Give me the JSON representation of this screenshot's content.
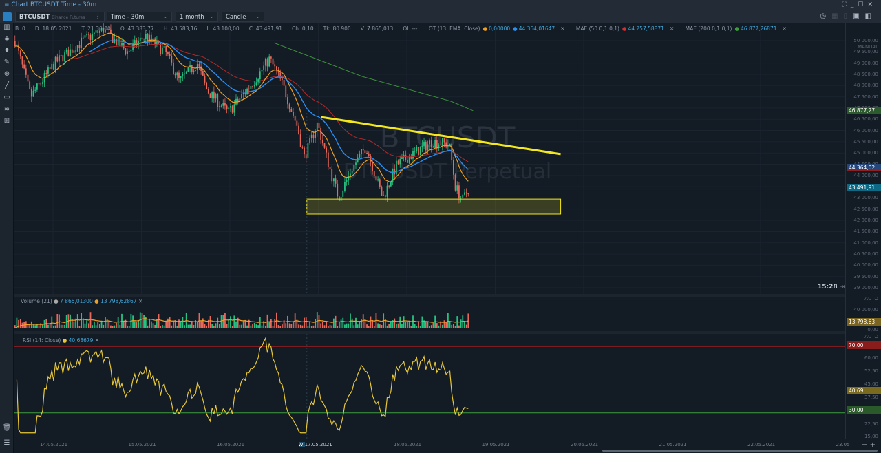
{
  "window": {
    "title": "Chart BTCUSDT Time - 30m",
    "controls": [
      "⛶",
      "_",
      "☐",
      "✕"
    ]
  },
  "toolbar": {
    "symbol": "BTCUSDT",
    "exchange": "Binance Futures",
    "timeframe": "Time - 30m",
    "range": "1 month",
    "chart_type": "Candle"
  },
  "legend": {
    "b": "B: 0",
    "d": "D: 18.05.2021",
    "t": "T: 21:30:00",
    "o": "O: 43 383,77",
    "h": "H: 43 583,16",
    "l": "L: 43 100,00",
    "c": "C: 43 491,91",
    "ch": "Ch: 0,10",
    "tk": "Tk: 80 900",
    "v": "V: 7 865,013",
    "oi": "OI: ---",
    "ind1": "OT (13: EMA: Close)",
    "ind1_v1": "0,00000",
    "ind1_v2": "44 364,01647",
    "ind2": "MAE (50:0,1:0,1)",
    "ind2_v": "44 257,58871",
    "ind3": "MAE (200:0,1:0,1)",
    "ind3_v": "46 877,26871",
    "mode": "MANUAL"
  },
  "price_axis": {
    "ticks": [
      "50 000,00",
      "49 500,00",
      "49 000,00",
      "48 500,00",
      "48 000,00",
      "47 500,00",
      "47 000,00",
      "46 500,00",
      "46 000,00",
      "45 500,00",
      "45 000,00",
      "44 500,00",
      "44 000,00",
      "43 500,00",
      "43 000,00",
      "42 500,00",
      "42 000,00",
      "41 500,00",
      "41 000,00",
      "40 500,00",
      "40 000,00",
      "39 500,00",
      "39 000,00"
    ],
    "badges": {
      "ma200": "46 877,27",
      "ema": "44 364,02",
      "last": "43 491,91"
    },
    "clock": "15:28"
  },
  "volume_pane": {
    "title": "Volume (21)",
    "v1": "7 865,01300",
    "v2": "13 798,62867",
    "axis_mode": "AUTO",
    "ticks": [
      "40 000,00",
      "0,00"
    ],
    "badge": "13 798,63"
  },
  "rsi_pane": {
    "title": "RSI (14: Close)",
    "value": "40,68679",
    "axis_mode": "AUTO",
    "ticks": [
      "60,00",
      "52,50",
      "45,00",
      "37,50",
      "22,50",
      "15,00"
    ],
    "upper": "70,00",
    "lower": "30,00",
    "badge": "40,69"
  },
  "time_axis": {
    "dates": [
      "14.05.2021",
      "15.05.2021",
      "16.05.2021",
      "17.05.2021",
      "18.05.2021",
      "19.05.2021",
      "20.05.2021",
      "21.05.2021",
      "22.05.2021",
      "23.05"
    ],
    "week_marker": "W"
  },
  "watermark": {
    "symbol": "BTCUSDT",
    "name": "BTC USDT Perpetual"
  },
  "colors": {
    "up": "#26c281",
    "down": "#e8685a",
    "ema": "#2a8ef0",
    "ma50": "#b02a2a",
    "ma200": "#3c8f3c",
    "fast": "#f0a020",
    "trend": "#f4e81c",
    "rsi": "#e8c838"
  },
  "chart_data": {
    "type": "candlestick",
    "x_unit": "days since 14.05.2021 00:00",
    "interval_minutes": 30,
    "close_waypoints": [
      [
        -0.43,
        50000
      ],
      [
        -0.25,
        47500
      ],
      [
        0.02,
        49000
      ],
      [
        0.34,
        50000
      ],
      [
        0.57,
        50500
      ],
      [
        0.84,
        49500
      ],
      [
        1.04,
        50200
      ],
      [
        1.27,
        49500
      ],
      [
        1.43,
        48200
      ],
      [
        1.63,
        49000
      ],
      [
        1.74,
        47800
      ],
      [
        1.98,
        46800
      ],
      [
        2.13,
        47500
      ],
      [
        2.29,
        48300
      ],
      [
        2.45,
        49200
      ],
      [
        2.6,
        48000
      ],
      [
        2.76,
        46200
      ],
      [
        2.84,
        44800
      ],
      [
        2.99,
        46300
      ],
      [
        3.15,
        44000
      ],
      [
        3.23,
        43000
      ],
      [
        3.38,
        44300
      ],
      [
        3.54,
        45300
      ],
      [
        3.66,
        43800
      ],
      [
        3.73,
        43000
      ],
      [
        3.89,
        44500
      ],
      [
        4.09,
        45000
      ],
      [
        4.28,
        45500
      ],
      [
        4.48,
        45400
      ],
      [
        4.55,
        43500
      ],
      [
        4.63,
        42900
      ],
      [
        4.71,
        43490
      ]
    ],
    "ma200_waypoints": [
      [
        2.5,
        49900
      ],
      [
        3.5,
        48400
      ],
      [
        4.5,
        47300
      ],
      [
        4.75,
        46880
      ]
    ],
    "trendline": [
      [
        3.03,
        46600
      ],
      [
        5.74,
        44950
      ]
    ],
    "support_zone": {
      "from": 2.87,
      "to": 5.74,
      "low": 42280,
      "high": 42950
    },
    "ylim": [
      39000,
      50000
    ],
    "rsi_levels": [
      30,
      70
    ]
  }
}
